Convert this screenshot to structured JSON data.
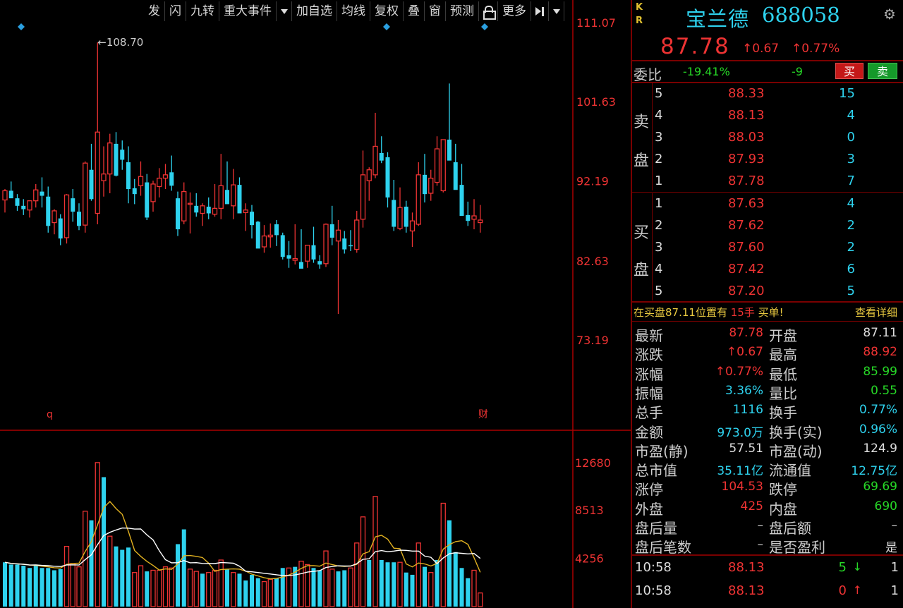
{
  "toolbar": {
    "items": [
      "发",
      "闪",
      "九转",
      "重大事件",
      "加自选",
      "均线",
      "复权",
      "叠",
      "窗",
      "预测",
      "更多"
    ]
  },
  "colors": {
    "up": "#ee3333",
    "down": "#2ed2ee",
    "ma5": "#ffffff",
    "ma10": "#e0b020",
    "axis": "#aa0000",
    "marker": "#2a9fe0"
  },
  "chart_data": [
    {
      "type": "candlestick",
      "title": "",
      "yaxis_ticks": [
        "111.07",
        "101.63",
        "92.19",
        "82.63",
        "73.19"
      ],
      "ylim": [
        73.19,
        111.07
      ],
      "annotation_max": "←108.70",
      "flag_left": "q",
      "flag_right": "财",
      "candles": [
        [
          89.9,
          91.2,
          88.4,
          91.0
        ],
        [
          91.0,
          92.1,
          90.3,
          90.1
        ],
        [
          90.1,
          90.6,
          88.6,
          89.2
        ],
        [
          89.2,
          90.0,
          88.1,
          88.8
        ],
        [
          88.7,
          89.6,
          87.8,
          89.8
        ],
        [
          89.8,
          91.8,
          89.0,
          91.1
        ],
        [
          90.9,
          92.6,
          89.0,
          90.4
        ],
        [
          90.3,
          91.5,
          86.0,
          86.8
        ],
        [
          87.2,
          88.8,
          85.8,
          88.6
        ],
        [
          87.7,
          88.2,
          84.5,
          85.3
        ],
        [
          85.4,
          90.6,
          84.7,
          90.5
        ],
        [
          90.1,
          91.2,
          87.3,
          88.5
        ],
        [
          88.5,
          89.5,
          86.3,
          86.8
        ],
        [
          86.9,
          94.5,
          86.0,
          94.3
        ],
        [
          93.5,
          96.6,
          89.8,
          90.0
        ],
        [
          88.3,
          108.7,
          87.0,
          98.0
        ],
        [
          92.2,
          96.3,
          90.3,
          93.0
        ],
        [
          93.0,
          97.8,
          90.7,
          96.7
        ],
        [
          96.6,
          98.0,
          92.7,
          92.8
        ],
        [
          95.9,
          97.0,
          93.5,
          94.7
        ],
        [
          94.4,
          96.3,
          89.5,
          91.2
        ],
        [
          91.3,
          92.4,
          89.4,
          90.6
        ],
        [
          91.6,
          94.5,
          90.4,
          92.7
        ],
        [
          92.0,
          93.0,
          87.5,
          87.8
        ],
        [
          89.7,
          92.2,
          88.5,
          91.8
        ],
        [
          91.5,
          93.7,
          90.2,
          92.5
        ],
        [
          92.5,
          94.2,
          91.2,
          92.9
        ],
        [
          93.2,
          95.2,
          91.0,
          91.6
        ],
        [
          90.1,
          90.9,
          85.6,
          86.4
        ],
        [
          87.4,
          92.0,
          87.0,
          90.9
        ],
        [
          89.4,
          90.8,
          85.9,
          89.5
        ],
        [
          89.2,
          90.7,
          87.9,
          88.4
        ],
        [
          88.3,
          89.5,
          86.8,
          89.2
        ],
        [
          89.1,
          90.2,
          87.6,
          88.3
        ],
        [
          88.2,
          91.8,
          87.9,
          88.9
        ],
        [
          88.9,
          95.4,
          87.6,
          91.6
        ],
        [
          91.1,
          94.5,
          89.5,
          89.4
        ],
        [
          89.2,
          93.6,
          87.6,
          91.7
        ],
        [
          91.7,
          92.6,
          90.2,
          88.3
        ],
        [
          88.4,
          89.5,
          86.2,
          88.7
        ],
        [
          88.5,
          89.3,
          85.3,
          86.9
        ],
        [
          87.3,
          87.4,
          84.8,
          84.1
        ],
        [
          84.3,
          86.9,
          83.6,
          85.6
        ],
        [
          85.5,
          87.1,
          84.2,
          85.7
        ],
        [
          87.0,
          87.5,
          84.4,
          85.7
        ],
        [
          85.7,
          86.0,
          82.8,
          83.1
        ],
        [
          83.3,
          85.0,
          81.8,
          82.9
        ],
        [
          82.7,
          87.0,
          82.2,
          82.9
        ],
        [
          82.5,
          86.4,
          82.2,
          81.7
        ],
        [
          82.6,
          83.6,
          81.8,
          84.5
        ],
        [
          84.5,
          86.7,
          82.4,
          82.8
        ],
        [
          82.6,
          83.3,
          81.7,
          82.2
        ],
        [
          82.3,
          87.1,
          81.9,
          87.0
        ],
        [
          87.0,
          89.2,
          84.5,
          85.4
        ],
        [
          85.0,
          87.5,
          76.3,
          86.3
        ],
        [
          85.3,
          86.2,
          83.5,
          84.0
        ],
        [
          84.5,
          86.3,
          83.8,
          84.4
        ],
        [
          84.0,
          88.6,
          83.6,
          87.5
        ],
        [
          87.6,
          95.8,
          86.6,
          92.9
        ],
        [
          92.2,
          93.8,
          89.8,
          93.5
        ],
        [
          92.9,
          100.3,
          92.5,
          96.3
        ],
        [
          95.5,
          97.5,
          94.3,
          94.6
        ],
        [
          95.0,
          95.6,
          89.0,
          90.2
        ],
        [
          89.9,
          92.3,
          86.2,
          86.7
        ],
        [
          86.5,
          91.4,
          86.3,
          89.0
        ],
        [
          89.1,
          89.8,
          86.0,
          86.7
        ],
        [
          86.2,
          88.4,
          84.3,
          87.4
        ],
        [
          87.0,
          94.4,
          86.8,
          92.9
        ],
        [
          92.9,
          95.4,
          89.6,
          90.6
        ],
        [
          90.7,
          93.5,
          89.8,
          92.5
        ],
        [
          92.0,
          97.5,
          91.6,
          96.0
        ],
        [
          91.0,
          96.8,
          90.8,
          97.1
        ],
        [
          97.1,
          103.8,
          95.2,
          94.6
        ],
        [
          94.4,
          96.6,
          91.3,
          91.1
        ],
        [
          91.7,
          94.2,
          88.5,
          88.0
        ],
        [
          88.1,
          89.7,
          86.8,
          87.4
        ],
        [
          87.6,
          90.0,
          86.4,
          88.0
        ],
        [
          87.2,
          89.3,
          86.0,
          87.5
        ]
      ]
    },
    {
      "type": "bar",
      "title": "",
      "yaxis_ticks": [
        "12680",
        "8513",
        "4256"
      ],
      "ylim": [
        0,
        14100
      ],
      "values": [
        [
          3900,
          "d"
        ],
        [
          3700,
          "d"
        ],
        [
          3700,
          "d"
        ],
        [
          3600,
          "d"
        ],
        [
          3400,
          "d"
        ],
        [
          3700,
          "d"
        ],
        [
          3400,
          "d"
        ],
        [
          3400,
          "d"
        ],
        [
          3200,
          "d"
        ],
        [
          3300,
          "d"
        ],
        [
          5300,
          "u"
        ],
        [
          3800,
          "u"
        ],
        [
          3500,
          "u"
        ],
        [
          8400,
          "u"
        ],
        [
          7600,
          "d"
        ],
        [
          12680,
          "u"
        ],
        [
          11400,
          "d"
        ],
        [
          6200,
          "u"
        ],
        [
          5300,
          "d"
        ],
        [
          5000,
          "d"
        ],
        [
          5200,
          "d"
        ],
        [
          3000,
          "u"
        ],
        [
          3600,
          "u"
        ],
        [
          3100,
          "d"
        ],
        [
          3200,
          "u"
        ],
        [
          3200,
          "u"
        ],
        [
          3500,
          "u"
        ],
        [
          3400,
          "u"
        ],
        [
          5500,
          "d"
        ],
        [
          6800,
          "d"
        ],
        [
          3300,
          "u"
        ],
        [
          3100,
          "u"
        ],
        [
          2900,
          "d"
        ],
        [
          3000,
          "u"
        ],
        [
          3200,
          "u"
        ],
        [
          4100,
          "u"
        ],
        [
          3300,
          "d"
        ],
        [
          3000,
          "u"
        ],
        [
          2900,
          "d"
        ],
        [
          2300,
          "d"
        ],
        [
          2800,
          "d"
        ],
        [
          2500,
          "d"
        ],
        [
          2200,
          "u"
        ],
        [
          2400,
          "u"
        ],
        [
          2500,
          "d"
        ],
        [
          3400,
          "d"
        ],
        [
          3400,
          "u"
        ],
        [
          3500,
          "d"
        ],
        [
          4000,
          "u"
        ],
        [
          3700,
          "u"
        ],
        [
          3400,
          "d"
        ],
        [
          3200,
          "d"
        ],
        [
          4900,
          "u"
        ],
        [
          3300,
          "u"
        ],
        [
          3100,
          "d"
        ],
        [
          3200,
          "d"
        ],
        [
          3400,
          "u"
        ],
        [
          5600,
          "u"
        ],
        [
          7900,
          "u"
        ],
        [
          4100,
          "d"
        ],
        [
          9700,
          "u"
        ],
        [
          4100,
          "d"
        ],
        [
          3900,
          "d"
        ],
        [
          3900,
          "d"
        ],
        [
          3900,
          "u"
        ],
        [
          3000,
          "d"
        ],
        [
          2800,
          "d"
        ],
        [
          5600,
          "u"
        ],
        [
          3500,
          "d"
        ],
        [
          3000,
          "u"
        ],
        [
          4100,
          "d"
        ],
        [
          9100,
          "u"
        ],
        [
          7600,
          "d"
        ],
        [
          4800,
          "d"
        ],
        [
          3400,
          "d"
        ],
        [
          2500,
          "d"
        ],
        [
          3200,
          "u"
        ],
        [
          1200,
          "u"
        ]
      ]
    }
  ],
  "panel": {
    "kr": [
      "K",
      "R"
    ],
    "name": "宝兰德",
    "code": "688058",
    "price": "87.78",
    "change": "↑0.67",
    "change_pct": "↑0.77%",
    "weibi_label": "委比",
    "weibi": "-19.41%",
    "weicha": "-9",
    "buy_btn": "买",
    "sell_btn": "卖",
    "sell_label": [
      "卖",
      "盘"
    ],
    "buy_label": [
      "买",
      "盘"
    ],
    "asks": [
      {
        "lvl": "5",
        "price": "88.33",
        "qty": "15"
      },
      {
        "lvl": "4",
        "price": "88.13",
        "qty": "4"
      },
      {
        "lvl": "3",
        "price": "88.03",
        "qty": "0"
      },
      {
        "lvl": "2",
        "price": "87.93",
        "qty": "3"
      },
      {
        "lvl": "1",
        "price": "87.78",
        "qty": "7"
      }
    ],
    "bids": [
      {
        "lvl": "1",
        "price": "87.63",
        "qty": "4"
      },
      {
        "lvl": "2",
        "price": "87.62",
        "qty": "2"
      },
      {
        "lvl": "3",
        "price": "87.60",
        "qty": "2"
      },
      {
        "lvl": "4",
        "price": "87.42",
        "qty": "6"
      },
      {
        "lvl": "5",
        "price": "87.20",
        "qty": "5"
      }
    ],
    "alert_pre": "在买盘87.11位置有",
    "alert_num": "15手",
    "alert_post": "买单!",
    "alert_detail": "查看详细",
    "stats": [
      {
        "l1": "最新",
        "v1": "87.78",
        "c1": "c-red",
        "l2": "开盘",
        "v2": "87.11",
        "c2": "c-white"
      },
      {
        "l1": "涨跌",
        "v1": "↑0.67",
        "c1": "c-red",
        "l2": "最高",
        "v2": "88.92",
        "c2": "c-red"
      },
      {
        "l1": "涨幅",
        "v1": "↑0.77%",
        "c1": "c-red",
        "l2": "最低",
        "v2": "85.99",
        "c2": "c-green"
      },
      {
        "l1": "振幅",
        "v1": "3.36%",
        "c1": "c-cyan",
        "l2": "量比",
        "v2": "0.55",
        "c2": "c-green"
      },
      {
        "l1": "总手",
        "v1": "1116",
        "c1": "c-cyan",
        "l2": "换手",
        "v2": "0.77%",
        "c2": "c-cyan"
      },
      {
        "l1": "金额",
        "v1": "973.0万",
        "c1": "c-cyan",
        "l2": "换手(实)",
        "v2": "0.96%",
        "c2": "c-cyan"
      },
      {
        "l1": "市盈(静)",
        "v1": "57.51",
        "c1": "c-white",
        "l2": "市盈(动)",
        "v2": "124.9",
        "c2": "c-white"
      },
      {
        "l1": "总市值",
        "v1": "35.11亿",
        "c1": "c-cyan",
        "l2": "流通值",
        "v2": "12.75亿",
        "c2": "c-cyan"
      },
      {
        "l1": "涨停",
        "v1": "104.53",
        "c1": "c-red",
        "l2": "跌停",
        "v2": "69.69",
        "c2": "c-green"
      },
      {
        "l1": "外盘",
        "v1": "425",
        "c1": "c-red",
        "l2": "内盘",
        "v2": "690",
        "c2": "c-green"
      },
      {
        "l1": "盘后量",
        "v1": "–",
        "c1": "c-gray",
        "l2": "盘后额",
        "v2": "–",
        "c2": "c-gray"
      },
      {
        "l1": "盘后笔数",
        "v1": "–",
        "c1": "c-gray",
        "l2": "是否盈利",
        "v2": "是",
        "c2": "c-white"
      }
    ],
    "ticks": [
      {
        "time": "10:58",
        "price": "88.13",
        "qty": "5",
        "dir": "down",
        "arrow": "↓",
        "num": "1"
      },
      {
        "time": "10:58",
        "price": "88.13",
        "qty": "0",
        "dir": "up",
        "arrow": "↑",
        "num": "1"
      }
    ]
  }
}
